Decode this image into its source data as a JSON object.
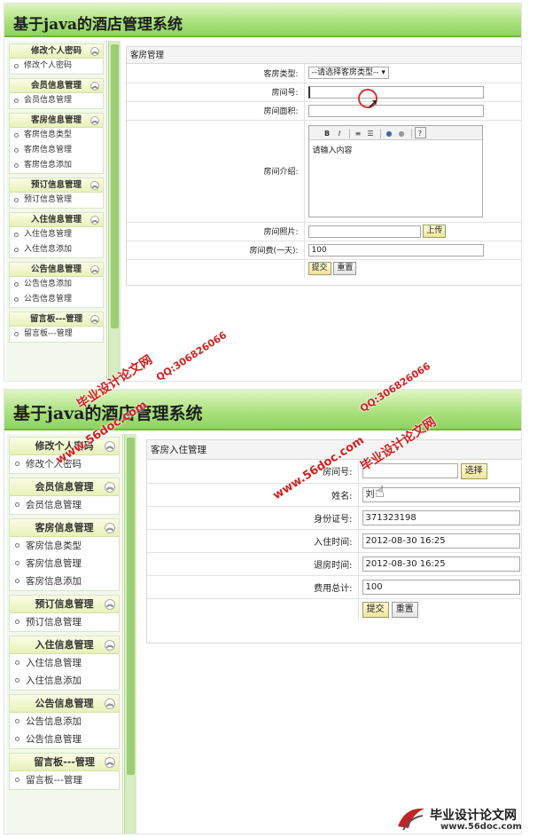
{
  "app_title": "基于java的酒店管理系统",
  "sidebar": {
    "groups": [
      {
        "title": "修改个人密码",
        "items": [
          "修改个人密码"
        ]
      },
      {
        "title": "会员信息管理",
        "items": [
          "会员信息管理"
        ]
      },
      {
        "title": "客房信息管理",
        "items": [
          "客房信息类型",
          "客房信息管理",
          "客房信息添加"
        ]
      },
      {
        "title": "预订信息管理",
        "items": [
          "预订信息管理"
        ]
      },
      {
        "title": "入住信息管理",
        "items": [
          "入住信息管理",
          "入住信息添加"
        ]
      },
      {
        "title": "公告信息管理",
        "items": [
          "公告信息添加",
          "公告信息管理"
        ]
      },
      {
        "title": "留言板---管理",
        "items": [
          "留言板---管理"
        ]
      }
    ]
  },
  "room_form": {
    "panel_title": "客房管理",
    "type_label": "客房类型:",
    "type_selected": "--请选择客房类型--",
    "number_label": "房间号:",
    "number_value": "",
    "area_label": "房间面积:",
    "area_value": "",
    "intro_label": "房间介绍:",
    "intro_placeholder": "请输入内容",
    "editor_tools": [
      "B",
      "I",
      "≡",
      "☰",
      "●",
      "●",
      "?"
    ],
    "photo_label": "房间照片:",
    "photo_value": "",
    "upload_button": "上传",
    "price_label": "房间费(一天):",
    "price_value": "100",
    "submit_button": "提交",
    "reset_button": "重置"
  },
  "checkin_form": {
    "panel_title": "客房入住管理",
    "room_label": "房间号:",
    "room_value": "",
    "choose_button": "选择",
    "name_label": "姓名:",
    "name_value": "刘",
    "id_label": "身份证号:",
    "id_value": "371323198",
    "checkin_label": "入住时间:",
    "checkin_value": "2012-08-30 16:25",
    "checkout_label": "退房时间:",
    "checkout_value": "2012-08-30 16:25",
    "total_label": "费用总计:",
    "total_value": "100",
    "submit_button": "提交",
    "reset_button": "重置"
  },
  "watermarks": {
    "site": "www.56doc.com",
    "qq": "QQ:306826066",
    "brand": "毕业设计论文网"
  },
  "footer_logo": {
    "text": "毕业设计论文网",
    "url": "www.56doc.com"
  },
  "colors": {
    "header_green": "#8fd362",
    "accent_yellow": "#eee59a",
    "watermark_red": "#d42020"
  }
}
